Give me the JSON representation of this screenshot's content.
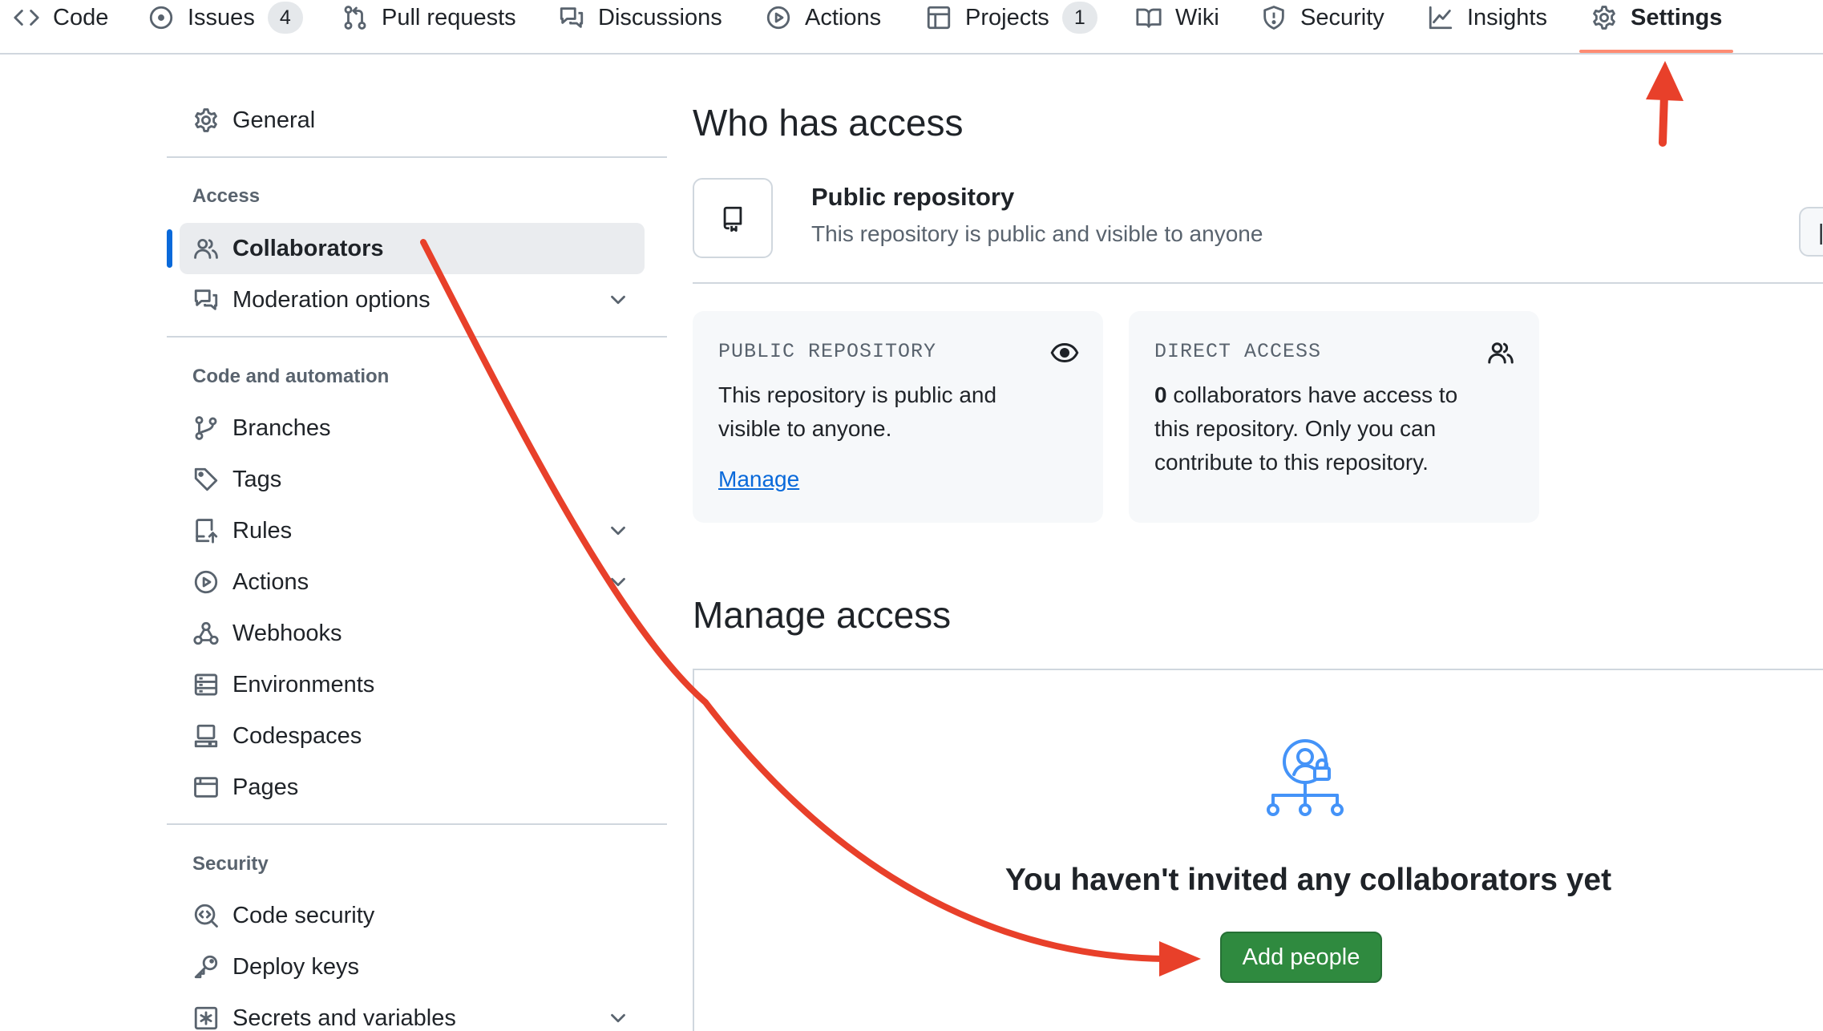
{
  "nav": {
    "tabs": [
      {
        "label": "Code",
        "icon": "code-icon"
      },
      {
        "label": "Issues",
        "icon": "issue-icon",
        "count": "4"
      },
      {
        "label": "Pull requests",
        "icon": "pull-request-icon"
      },
      {
        "label": "Discussions",
        "icon": "discussion-icon"
      },
      {
        "label": "Actions",
        "icon": "play-icon"
      },
      {
        "label": "Projects",
        "icon": "table-icon",
        "count": "1"
      },
      {
        "label": "Wiki",
        "icon": "book-icon"
      },
      {
        "label": "Security",
        "icon": "shield-icon"
      },
      {
        "label": "Insights",
        "icon": "graph-icon"
      },
      {
        "label": "Settings",
        "icon": "gear-icon",
        "selected": true
      }
    ]
  },
  "sidebar": {
    "general": "General",
    "sections": {
      "access": "Access",
      "code_automation": "Code and automation",
      "security": "Security"
    },
    "items": {
      "collaborators": "Collaborators",
      "moderation": "Moderation options",
      "branches": "Branches",
      "tags": "Tags",
      "rules": "Rules",
      "actions": "Actions",
      "webhooks": "Webhooks",
      "environments": "Environments",
      "codespaces": "Codespaces",
      "pages": "Pages",
      "code_security": "Code security",
      "deploy_keys": "Deploy keys",
      "secrets": "Secrets and variables"
    },
    "active": "Collaborators"
  },
  "main": {
    "who_title": "Who has access",
    "visibility": {
      "title": "Public repository",
      "desc": "This repository is public and visible to anyone"
    },
    "cards": {
      "public": {
        "label": "PUBLIC REPOSITORY",
        "line1": "This repository is public and",
        "line2": "visible to anyone.",
        "link": "Manage"
      },
      "direct": {
        "label": "DIRECT ACCESS",
        "count": "0",
        "line1_rest": " collaborators have access to",
        "line2": "this repository. Only you can",
        "line3": "contribute to this repository."
      }
    },
    "manage_title": "Manage access",
    "empty_title": "You haven't invited any collaborators yet",
    "add_button": "Add people"
  },
  "colors": {
    "accent_blue": "#0969da",
    "tab_underline": "#fd8c73",
    "add_button_green": "#2f8a3f",
    "annotation_red": "#e8402a",
    "muted_text": "#59636e"
  },
  "annotations": {
    "arrows": [
      "arrow-to-settings-tab",
      "arrow-from-collaborators-to-add-people"
    ]
  }
}
